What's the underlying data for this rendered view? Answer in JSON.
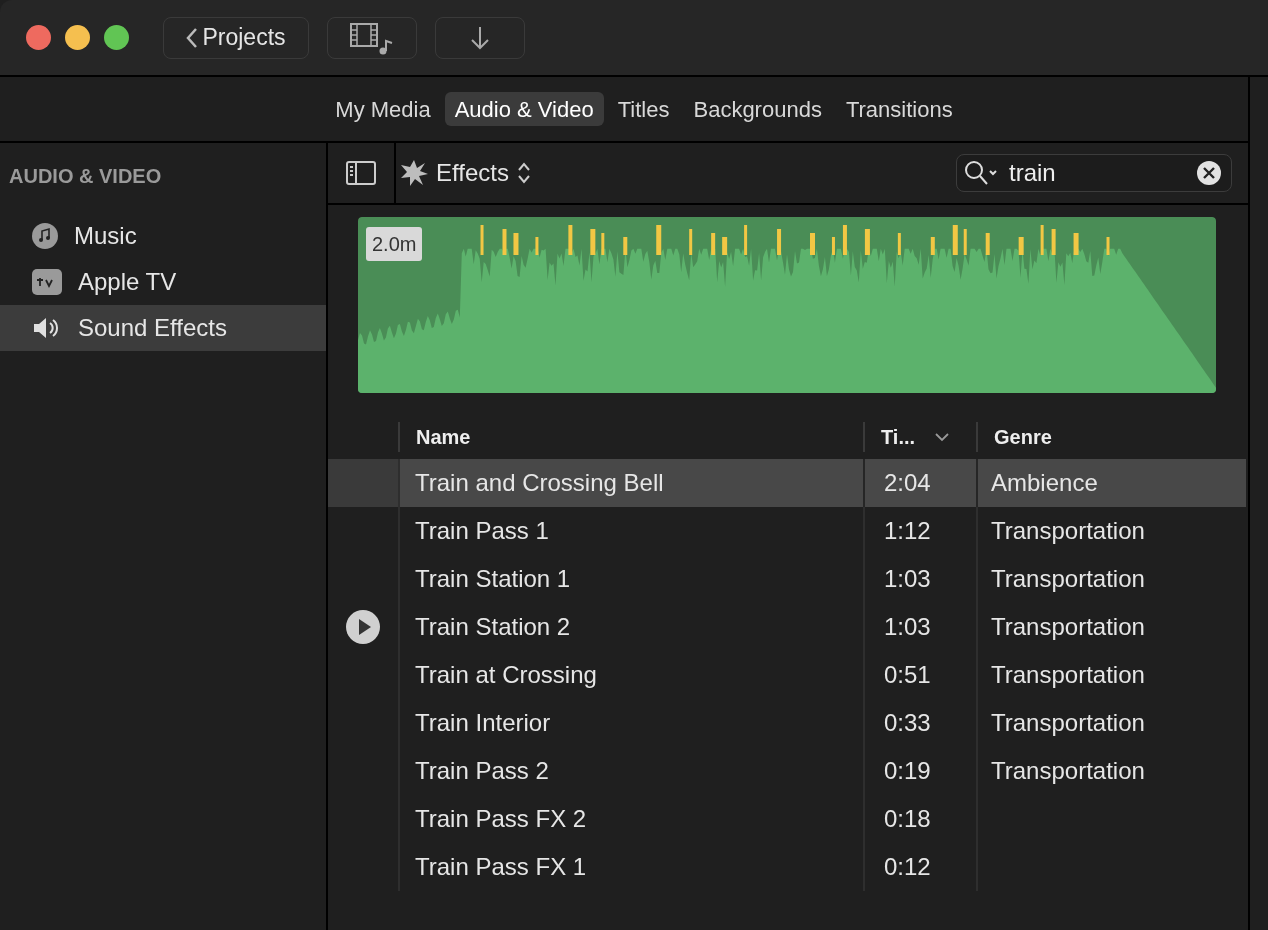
{
  "toolbar": {
    "back_button": "Projects"
  },
  "tabs": [
    {
      "label": "My Media",
      "selected": false
    },
    {
      "label": "Audio & Video",
      "selected": true
    },
    {
      "label": "Titles",
      "selected": false
    },
    {
      "label": "Backgrounds",
      "selected": false
    },
    {
      "label": "Transitions",
      "selected": false
    }
  ],
  "sidebar": {
    "heading": "AUDIO & VIDEO",
    "items": [
      {
        "label": "Music",
        "kind": "music",
        "selected": false
      },
      {
        "label": "Apple TV",
        "kind": "tv",
        "selected": false
      },
      {
        "label": "Sound Effects",
        "kind": "sound",
        "selected": true
      }
    ]
  },
  "browser": {
    "category": "Effects",
    "search": {
      "value": "train"
    },
    "waveform": {
      "duration": "2.0m"
    },
    "columns": [
      "Name",
      "Ti...",
      "Genre"
    ],
    "rows": [
      {
        "name": "Train and Crossing Bell",
        "time": "2:04",
        "genre": "Ambience",
        "selected": true,
        "hovered": false
      },
      {
        "name": "Train Pass 1",
        "time": "1:12",
        "genre": "Transportation",
        "selected": false,
        "hovered": false
      },
      {
        "name": "Train Station 1",
        "time": "1:03",
        "genre": "Transportation",
        "selected": false,
        "hovered": false
      },
      {
        "name": "Train Station 2",
        "time": "1:03",
        "genre": "Transportation",
        "selected": false,
        "hovered": true
      },
      {
        "name": "Train at Crossing",
        "time": "0:51",
        "genre": "Transportation",
        "selected": false,
        "hovered": false
      },
      {
        "name": "Train Interior",
        "time": "0:33",
        "genre": "Transportation",
        "selected": false,
        "hovered": false
      },
      {
        "name": "Train Pass 2",
        "time": "0:19",
        "genre": "Transportation",
        "selected": false,
        "hovered": false
      },
      {
        "name": "Train Pass FX 2",
        "time": "0:18",
        "genre": "",
        "selected": false,
        "hovered": false
      },
      {
        "name": "Train Pass FX 1",
        "time": "0:12",
        "genre": "",
        "selected": false,
        "hovered": false
      }
    ]
  }
}
